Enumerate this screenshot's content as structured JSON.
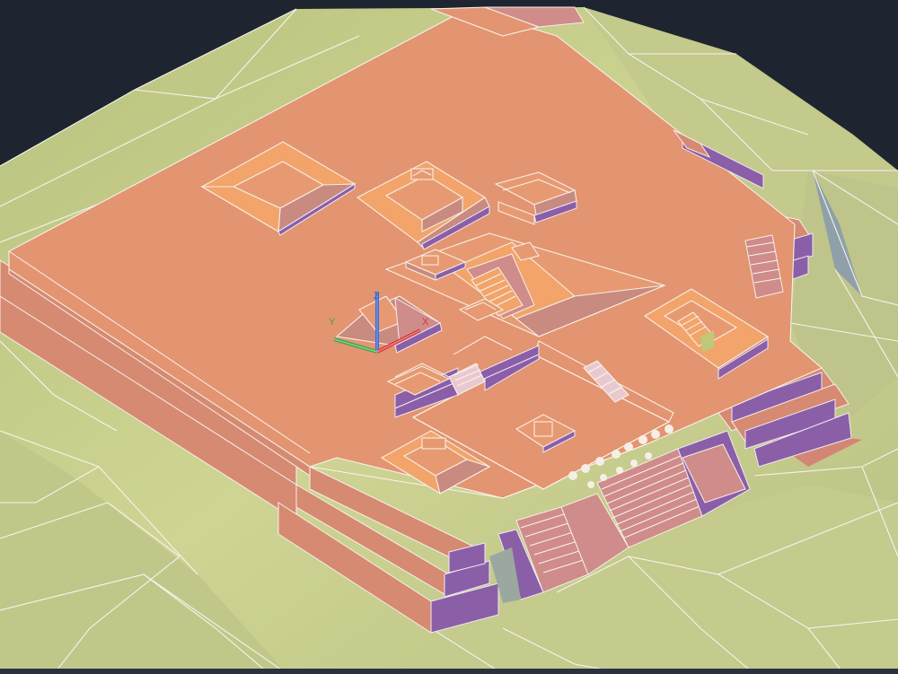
{
  "viewport": {
    "background_color": "#1e2530",
    "terrain_color": "#c9cf8e",
    "platform_color": "#e39470",
    "accent_purple": "#8a5fa8"
  },
  "ucs_icon": {
    "x_label": "X",
    "y_label": "Y",
    "z_label": "Z",
    "x_color": "#d83a3a",
    "y_color": "#3aa84a",
    "z_color": "#3a6ad8"
  }
}
